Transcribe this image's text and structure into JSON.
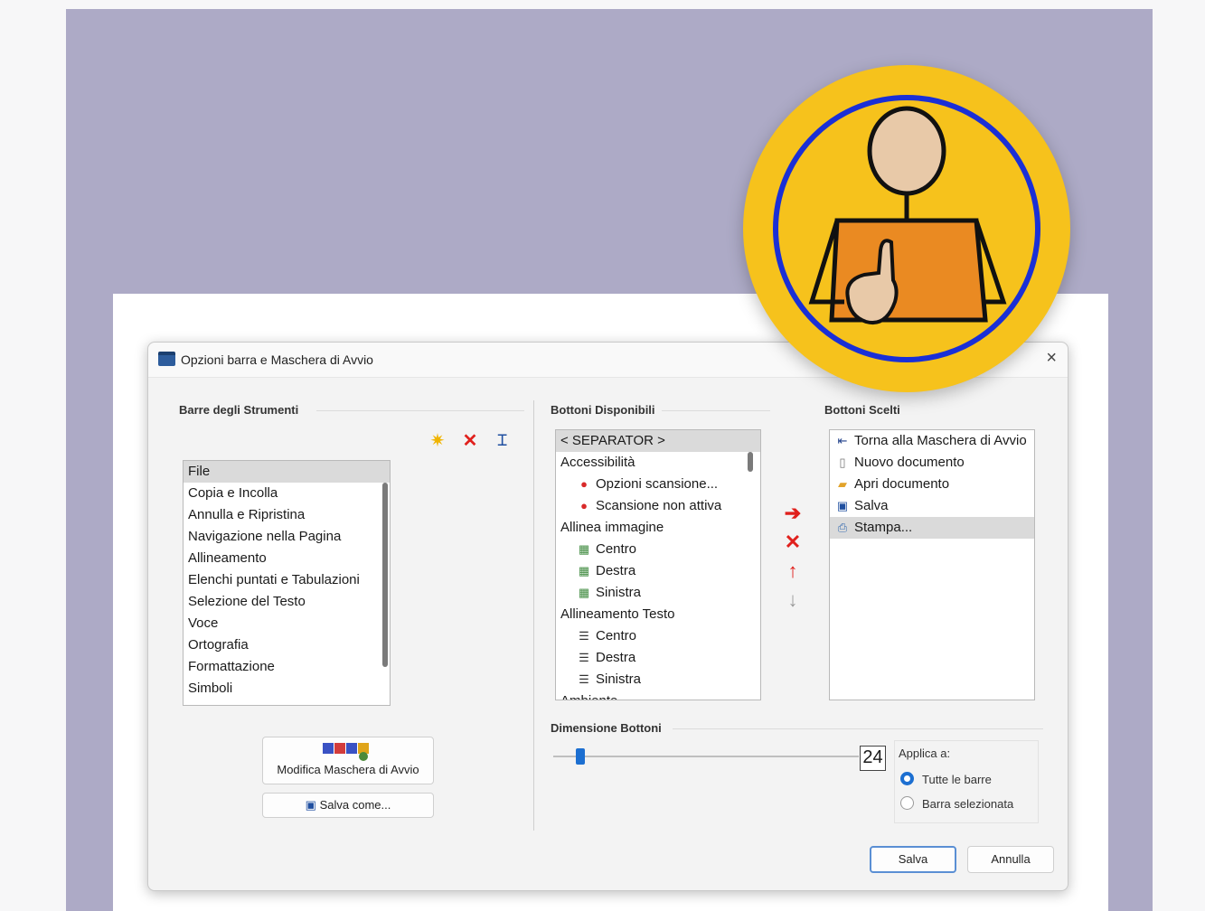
{
  "dialog": {
    "title": "Opzioni barra e Maschera di Avvio",
    "close_label": "×"
  },
  "toolbars": {
    "group_label": "Barre degli Strumenti",
    "items": [
      "File",
      "Copia e Incolla",
      "Annulla e Ripristina",
      "Navigazione nella Pagina",
      "Allineamento",
      "Elenchi puntati e Tabulazioni",
      "Selezione del Testo",
      "Voce",
      "Ortografia",
      "Formattazione",
      "Simboli"
    ],
    "selected_index": 0,
    "new_icon": "sparkle-icon",
    "delete_icon": "delete-x-icon",
    "rename_icon": "rename-icon",
    "edit_start_label": "Modifica Maschera di Avvio",
    "save_as_label": "Salva come..."
  },
  "available": {
    "group_label": "Bottoni Disponibili",
    "items": [
      {
        "label": "< SEPARATOR >",
        "child": false,
        "icon": ""
      },
      {
        "label": "Accessibilità",
        "child": false,
        "icon": ""
      },
      {
        "label": "Opzioni scansione...",
        "child": true,
        "icon": "scan-options-icon"
      },
      {
        "label": "Scansione non attiva",
        "child": true,
        "icon": "scan-off-icon"
      },
      {
        "label": "Allinea immagine",
        "child": false,
        "icon": ""
      },
      {
        "label": "Centro",
        "child": true,
        "icon": "image-center-icon"
      },
      {
        "label": "Destra",
        "child": true,
        "icon": "image-right-icon"
      },
      {
        "label": "Sinistra",
        "child": true,
        "icon": "image-left-icon"
      },
      {
        "label": "Allineamento Testo",
        "child": false,
        "icon": ""
      },
      {
        "label": "Centro",
        "child": true,
        "icon": "text-center-icon"
      },
      {
        "label": "Destra",
        "child": true,
        "icon": "text-right-icon"
      },
      {
        "label": "Sinistra",
        "child": true,
        "icon": "text-left-icon"
      },
      {
        "label": "Ambiente",
        "child": false,
        "icon": ""
      }
    ]
  },
  "chosen": {
    "group_label": "Bottoni Scelti",
    "items": [
      {
        "label": "Torna alla Maschera di Avvio",
        "icon": "return-icon"
      },
      {
        "label": "Nuovo documento",
        "icon": "new-document-icon"
      },
      {
        "label": "Apri documento",
        "icon": "open-folder-icon"
      },
      {
        "label": "Salva",
        "icon": "save-disk-icon"
      },
      {
        "label": "Stampa...",
        "icon": "printer-icon"
      }
    ],
    "selected_index": 4
  },
  "arrows": {
    "add_icon": "arrow-right-icon",
    "remove_icon": "remove-x-icon",
    "up_icon": "arrow-up-icon",
    "down_icon": "arrow-down-icon"
  },
  "size": {
    "group_label": "Dimensione Bottoni",
    "value": "24",
    "slider_fraction": 0.09,
    "apply_label": "Applica a:",
    "option_all": "Tutte le barre",
    "option_selected": "Barra selezionata",
    "selected_option": "all"
  },
  "footer": {
    "save_label": "Salva",
    "cancel_label": "Annulla"
  },
  "colors": {
    "accent": "#1c6fd1",
    "badge_yellow": "#f6c21c",
    "badge_ring": "#1a2fd6",
    "shirt_orange": "#ea8a22",
    "red_icon": "#e0201c"
  }
}
